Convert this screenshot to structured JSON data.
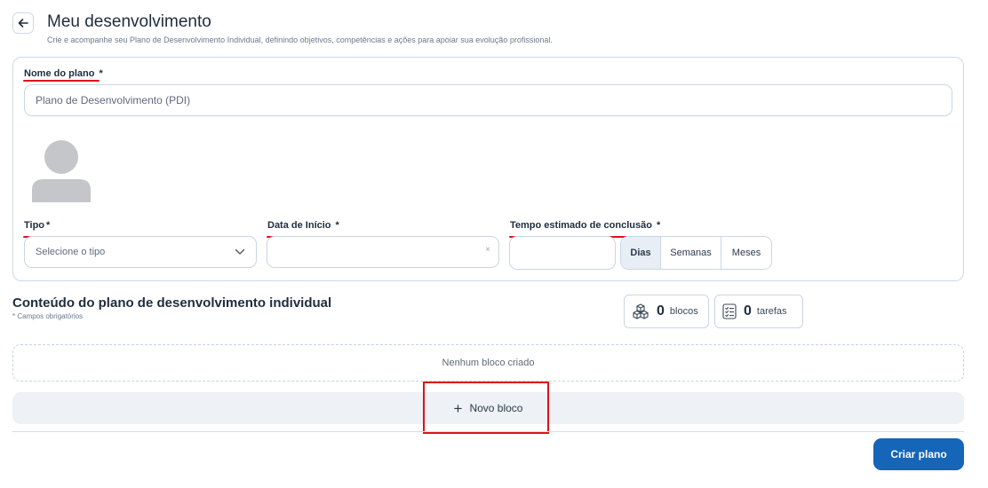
{
  "header": {
    "title": "Meu desenvolvimento",
    "subtitle": "Crie e acompanhe seu Plano de Desenvolvimento Individual, definindo objetivos, competências e ações para apoiar sua evolução profissional."
  },
  "form": {
    "plan_name": {
      "label": "Nome do plano",
      "required": "*",
      "placeholder": "Plano de Desenvolvimento (PDI)",
      "value": ""
    },
    "type": {
      "label": "Tipo",
      "required": "*",
      "placeholder": "Selecione o tipo"
    },
    "start_date": {
      "label": "Data de Início",
      "required": "*",
      "clear_symbol": "×"
    },
    "estimated_time": {
      "label": "Tempo estimado de conclusão",
      "required": "*",
      "units": [
        "Dias",
        "Semanas",
        "Meses"
      ],
      "selected_unit": "Dias"
    }
  },
  "content": {
    "title": "Conteúdo do plano de desenvolvimento individual",
    "required_note": "* Campos obrigatórios",
    "blocks_count": "0",
    "blocks_label": "blocos",
    "tasks_count": "0",
    "tasks_label": "tarefas",
    "empty_text": "Nenhum bloco criado",
    "new_block_label": "Novo bloco"
  },
  "actions": {
    "create_label": "Criar plano"
  },
  "colors": {
    "primary": "#1565b8",
    "annotation": "#e0101a",
    "border": "#c9dbe8"
  }
}
